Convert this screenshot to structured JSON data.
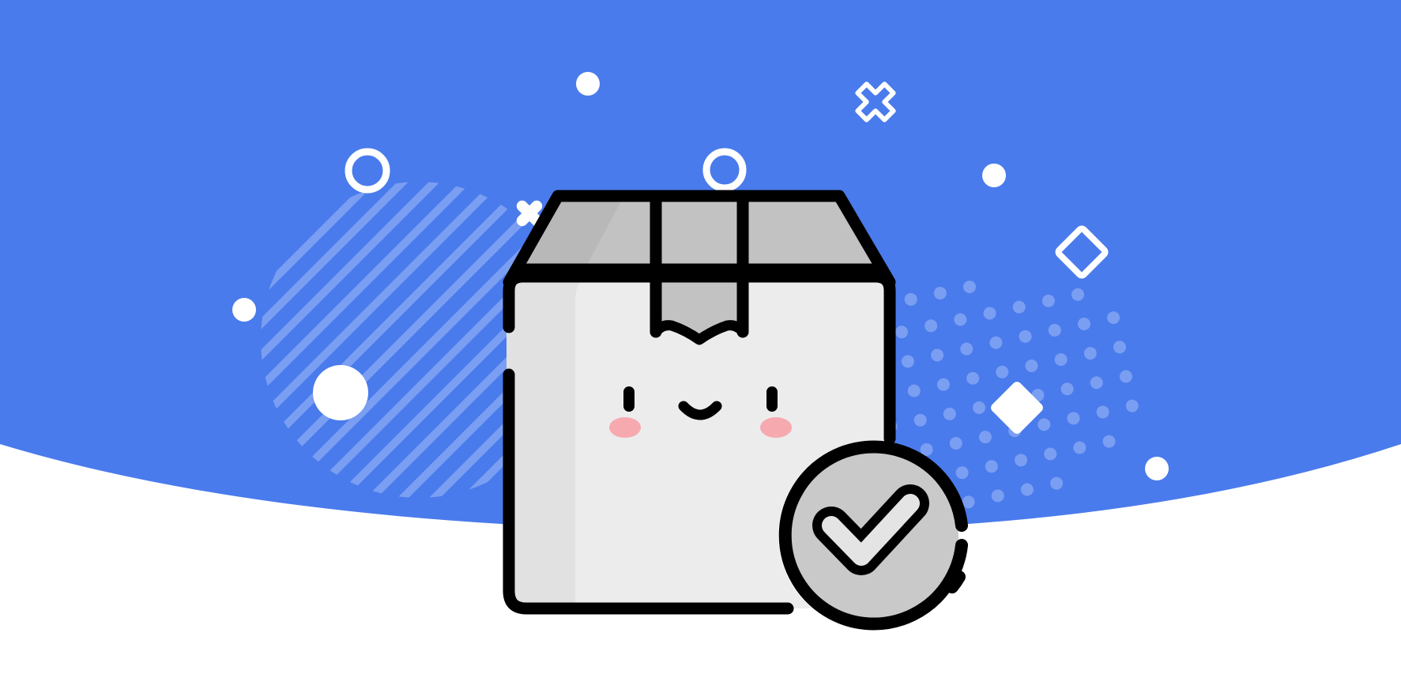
{
  "colors": {
    "banner_blue": "#4a7bec",
    "page_background": "#ffffff",
    "pattern_light": "#7a9ef2",
    "outline": "#000000",
    "box_front": "#ececec",
    "box_side": "#e1e1e1",
    "box_lid": "#c2c2c2",
    "badge_fill": "#c9c9c9",
    "badge_check": "#e4e4e4",
    "cheek_pink": "#f7a9b0",
    "decoration_white": "#ffffff"
  },
  "illustration": {
    "subject": "cardboard-box-with-face",
    "badge_icon": "checkmark-icon",
    "decorations": [
      "circle-dot",
      "ring",
      "plus-cross",
      "diamond",
      "striped-circle",
      "dot-grid"
    ]
  }
}
